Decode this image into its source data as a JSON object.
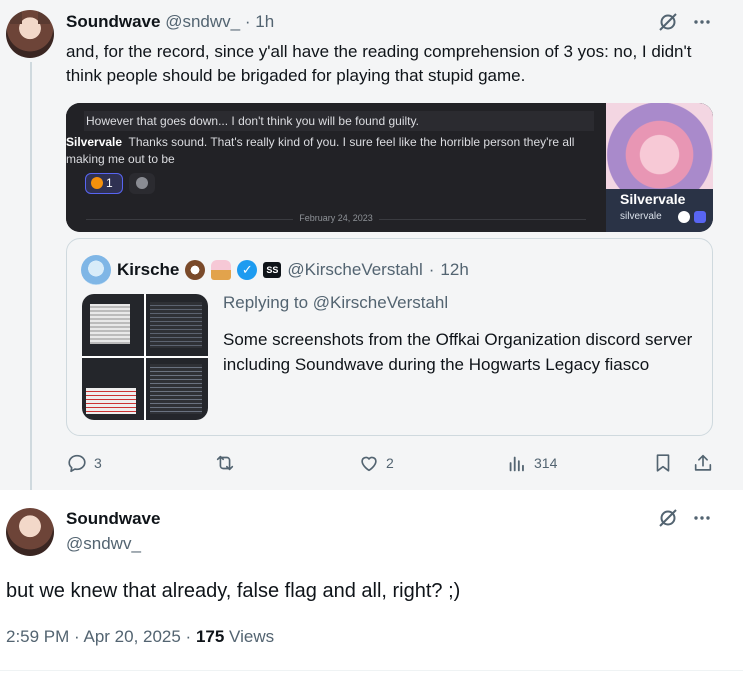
{
  "tweet1": {
    "name": "Soundwave",
    "handle": "@sndwv_",
    "separator": "·",
    "time": "1h",
    "text": "and, for the record, since y'all have the reading comprehension of 3 yos: no, I didn't think people should be brigaded for playing that stupid game.",
    "screenshot": {
      "line1": "However that goes down... I don't think you will be found guilty.",
      "author": "Silvervale",
      "message": "Thanks sound. That's really kind of you. I sure feel like the horrible person they're all making me out to be",
      "reaction_count": "1",
      "date": "February 24, 2023",
      "profile_name": "Silvervale",
      "profile_handle": "silvervale"
    },
    "quote": {
      "name": "Kirsche",
      "handle": "@KirscheVerstahl",
      "separator": "·",
      "time": "12h",
      "affiliate_badge": "SS",
      "replying_to": "Replying to @KirscheVerstahl",
      "text": "Some screenshots from the Offkai Organization discord server including Soundwave during the Hogwarts Legacy fiasco"
    },
    "actions": {
      "replies": "3",
      "likes": "2",
      "views": "314"
    }
  },
  "tweet2": {
    "name": "Soundwave",
    "handle": "@sndwv_",
    "text": "but we knew that already, false flag and all, right? ;)",
    "time": "2:59 PM · Apr 20, 2025 · ",
    "views_count": "175",
    "views_label": " Views"
  },
  "colors": {
    "accent": "#1d9bf0",
    "muted": "#536471",
    "text": "#0f1419",
    "border": "#cfd9de"
  },
  "icons": [
    "grok-icon",
    "more-icon",
    "reply-icon",
    "retweet-icon",
    "like-icon",
    "views-icon",
    "bookmark-icon",
    "share-icon",
    "verified-icon"
  ]
}
